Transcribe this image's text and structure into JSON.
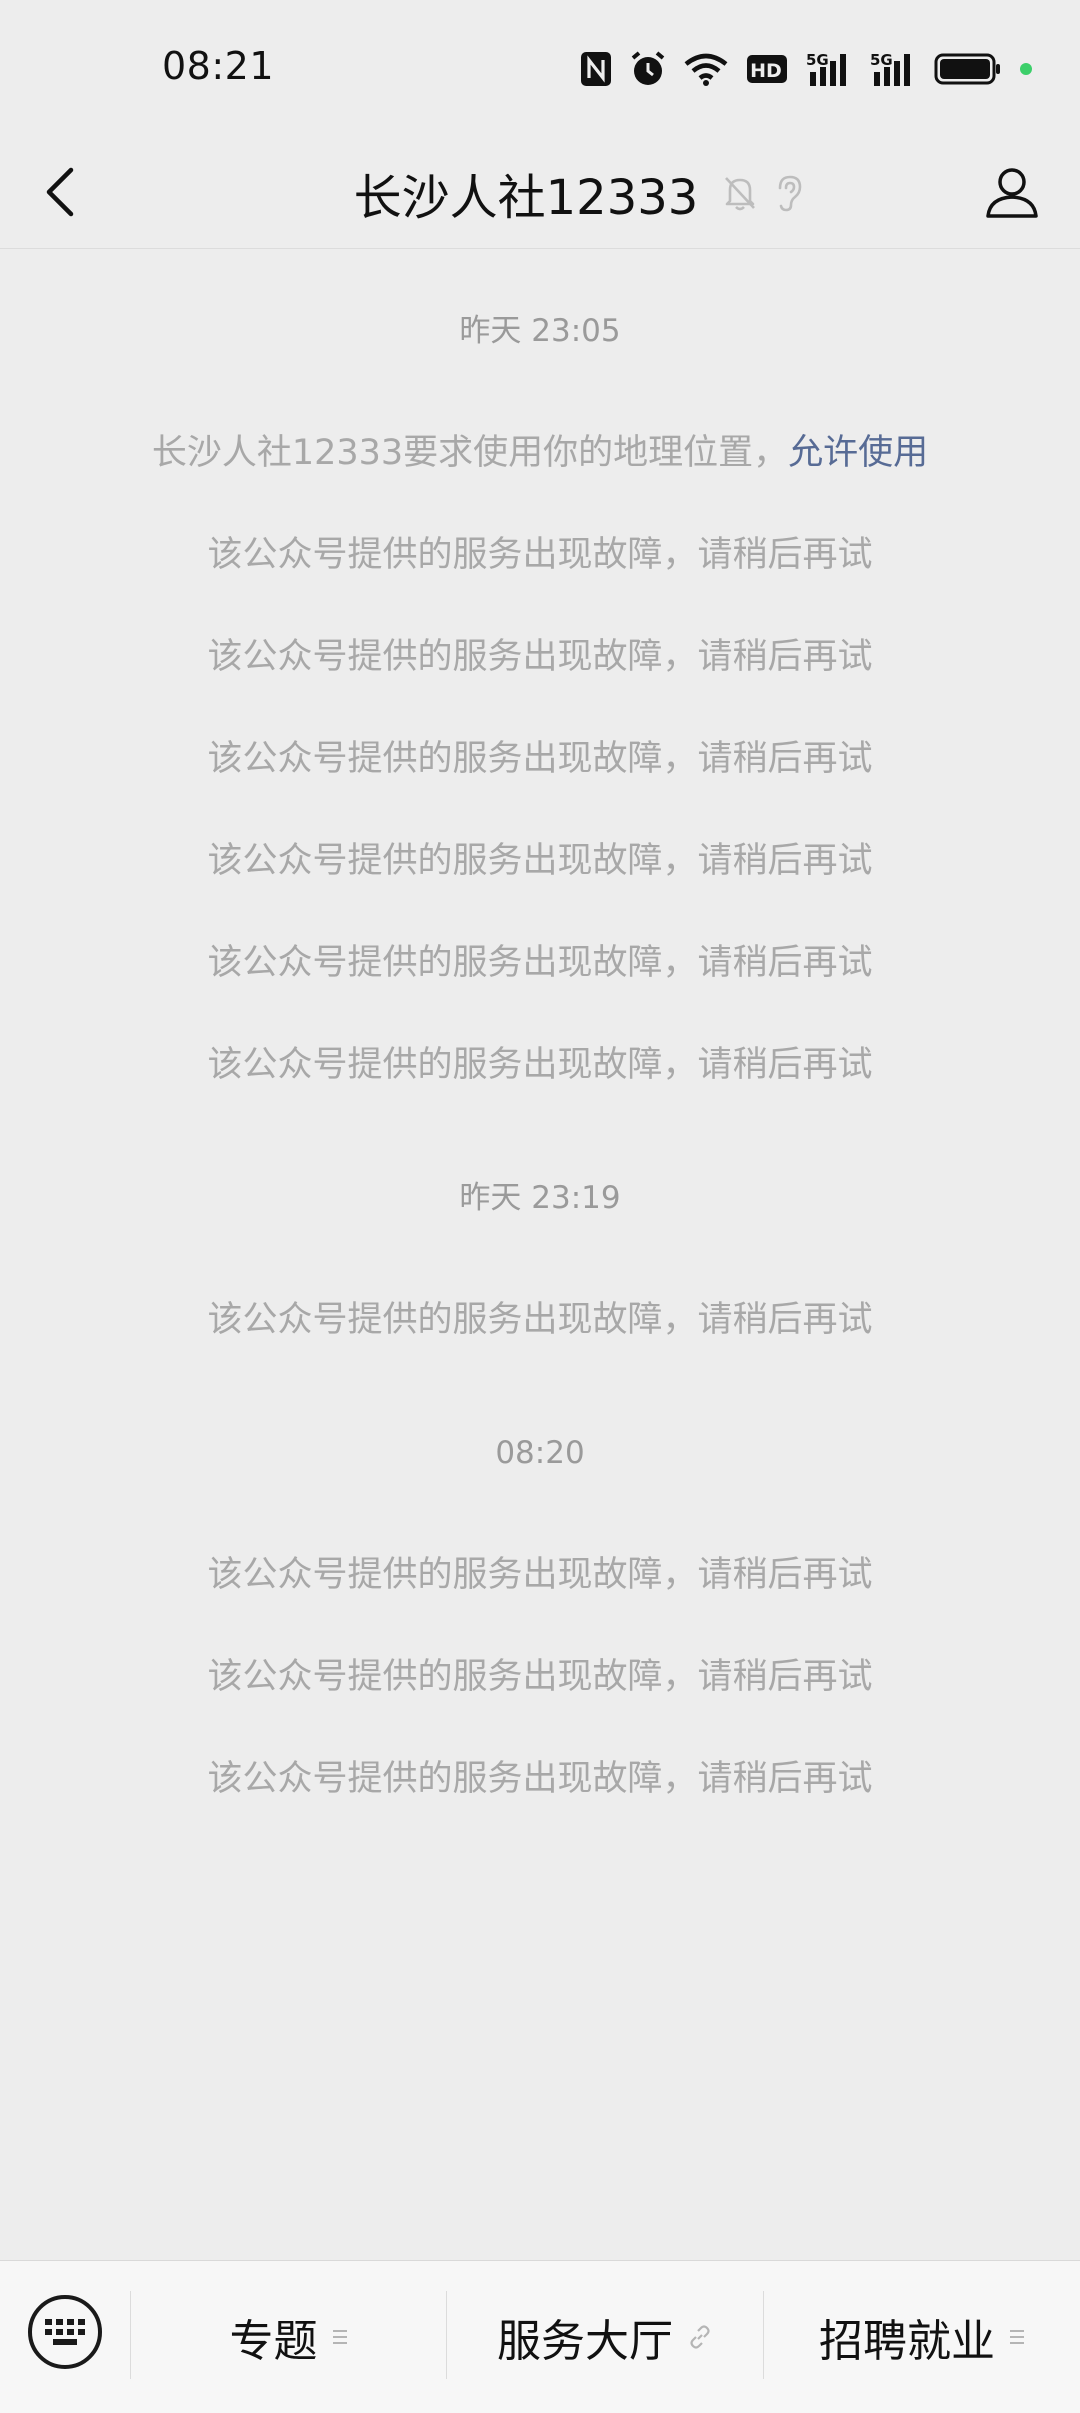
{
  "status_bar": {
    "time": "08:21",
    "icons": [
      "nfc-icon",
      "alarm-icon",
      "wifi-icon",
      "hd-icon",
      "signal-5g-icon",
      "signal-5g-icon",
      "battery-icon"
    ],
    "hd_label": "HD",
    "net_label_1": "5G",
    "net_label_2": "5G"
  },
  "header": {
    "title": "长沙人社12333",
    "back_icon": "chevron-left-icon",
    "mute_icon": "bell-off-icon",
    "ear_icon": "ear-icon",
    "profile_icon": "user-icon"
  },
  "chat": {
    "groups": [
      {
        "timestamp": "昨天 23:05",
        "location_request": {
          "text": "长沙人社12333要求使用你的地理位置，",
          "link": "允许使用"
        },
        "messages": [
          "该公众号提供的服务出现故障，请稍后再试",
          "该公众号提供的服务出现故障，请稍后再试",
          "该公众号提供的服务出现故障，请稍后再试",
          "该公众号提供的服务出现故障，请稍后再试",
          "该公众号提供的服务出现故障，请稍后再试",
          "该公众号提供的服务出现故障，请稍后再试"
        ]
      },
      {
        "timestamp": "昨天 23:19",
        "messages": [
          "该公众号提供的服务出现故障，请稍后再试"
        ]
      },
      {
        "timestamp": "08:20",
        "messages": [
          "该公众号提供的服务出现故障，请稍后再试",
          "该公众号提供的服务出现故障，请稍后再试",
          "该公众号提供的服务出现故障，请稍后再试"
        ]
      }
    ]
  },
  "bottom_menu": {
    "keyboard_icon": "keyboard-icon",
    "items": [
      {
        "label": "专题",
        "icon": "menu-lines-icon"
      },
      {
        "label": "服务大厅",
        "icon": "link-icon"
      },
      {
        "label": "招聘就业",
        "icon": "menu-lines-icon"
      }
    ]
  },
  "colors": {
    "background": "#ededed",
    "system_text": "#a8a8a8",
    "link": "#576b95",
    "online_dot": "#3ccf6a"
  }
}
